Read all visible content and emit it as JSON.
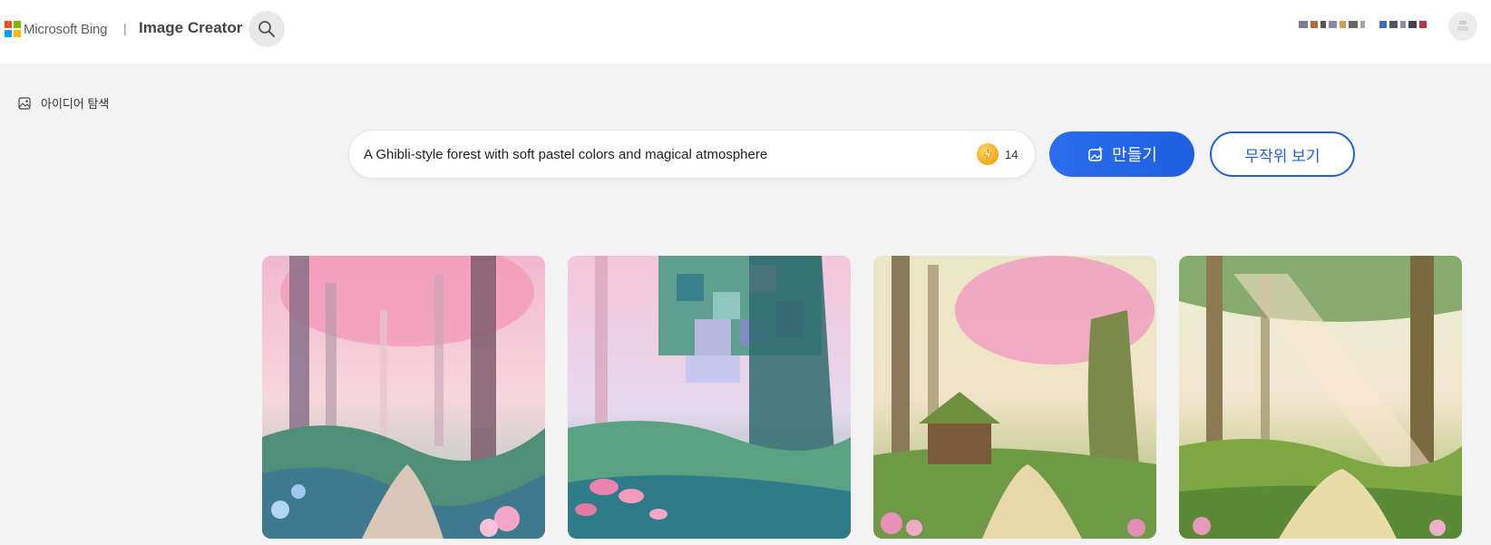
{
  "header": {
    "brand": "Microsoft Bing",
    "separator": "|",
    "product": "Image Creator",
    "search_icon": "search-icon",
    "user_name_icon": "blurred-username",
    "avatar_icon": "user-avatar-icon"
  },
  "sidebar": {
    "explore_label": "아이디어 탐색",
    "explore_icon": "image-icon"
  },
  "prompt": {
    "value": "A Ghibli-style forest with soft pastel colors and magical atmosphere",
    "boost_icon": "lightning-coin-icon",
    "boost_count": "14"
  },
  "actions": {
    "create_label": "만들기",
    "create_icon": "sparkle-image-icon",
    "random_label": "무작위 보기"
  },
  "results": {
    "images": [
      {
        "name": "forest-image-1"
      },
      {
        "name": "forest-image-2"
      },
      {
        "name": "forest-image-3"
      },
      {
        "name": "forest-image-4"
      }
    ]
  },
  "colors": {
    "accent": "#1f5fe0",
    "background": "#f3f3f3",
    "ms_red": "#f25022",
    "ms_green": "#7fba00",
    "ms_blue": "#00a4ef",
    "ms_yellow": "#ffb900"
  }
}
